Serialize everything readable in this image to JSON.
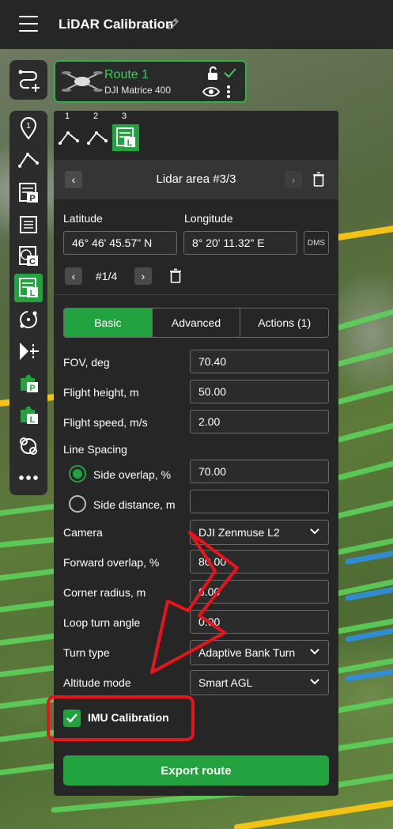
{
  "header": {
    "title": "LiDAR Calibration"
  },
  "route": {
    "name": "Route 1",
    "model": "DJI Matrice 400"
  },
  "steps": [
    {
      "label": "1"
    },
    {
      "label": "2"
    },
    {
      "label": "3"
    }
  ],
  "section": {
    "title": "Lidar area #3/3"
  },
  "coords": {
    "lat_label": "Latitude",
    "lat_value": "46° 46' 45.57\" N",
    "lon_label": "Longitude",
    "lon_value": "8° 20' 11.32\" E",
    "format_button": "DMS"
  },
  "point_nav": {
    "label": "#1/4"
  },
  "tabs": [
    {
      "label": "Basic"
    },
    {
      "label": "Advanced"
    },
    {
      "label": "Actions (1)"
    }
  ],
  "params": {
    "fov_label": "FOV, deg",
    "fov_value": "70.40",
    "height_label": "Flight height, m",
    "height_value": "50.00",
    "speed_label": "Flight speed, m/s",
    "speed_value": "2.00",
    "spacing_label": "Line Spacing",
    "side_overlap_label": "Side overlap, %",
    "side_overlap_value": "70.00",
    "side_distance_label": "Side distance, m",
    "side_distance_value": "",
    "camera_label": "Camera",
    "camera_value": "DJI Zenmuse L2",
    "forward_overlap_label": "Forward overlap, %",
    "forward_overlap_value": "80.00",
    "corner_radius_label": "Corner radius, m",
    "corner_radius_value": "6.00",
    "loop_angle_label": "Loop turn angle",
    "loop_angle_value": "0.00",
    "turn_type_label": "Turn type",
    "turn_type_value": "Adaptive Bank Turn",
    "altitude_label": "Altitude mode",
    "altitude_value": "Smart AGL"
  },
  "imu": {
    "label": "IMU Calibration",
    "checked": true
  },
  "export": {
    "label": "Export route"
  },
  "colors": {
    "accent": "#22a33f",
    "panel": "#262626",
    "annotation": "#e8141b",
    "flight_line": "#5cd65c",
    "flight_line_blue": "#2e8fe0",
    "flight_line_yellow": "#f2c314"
  }
}
